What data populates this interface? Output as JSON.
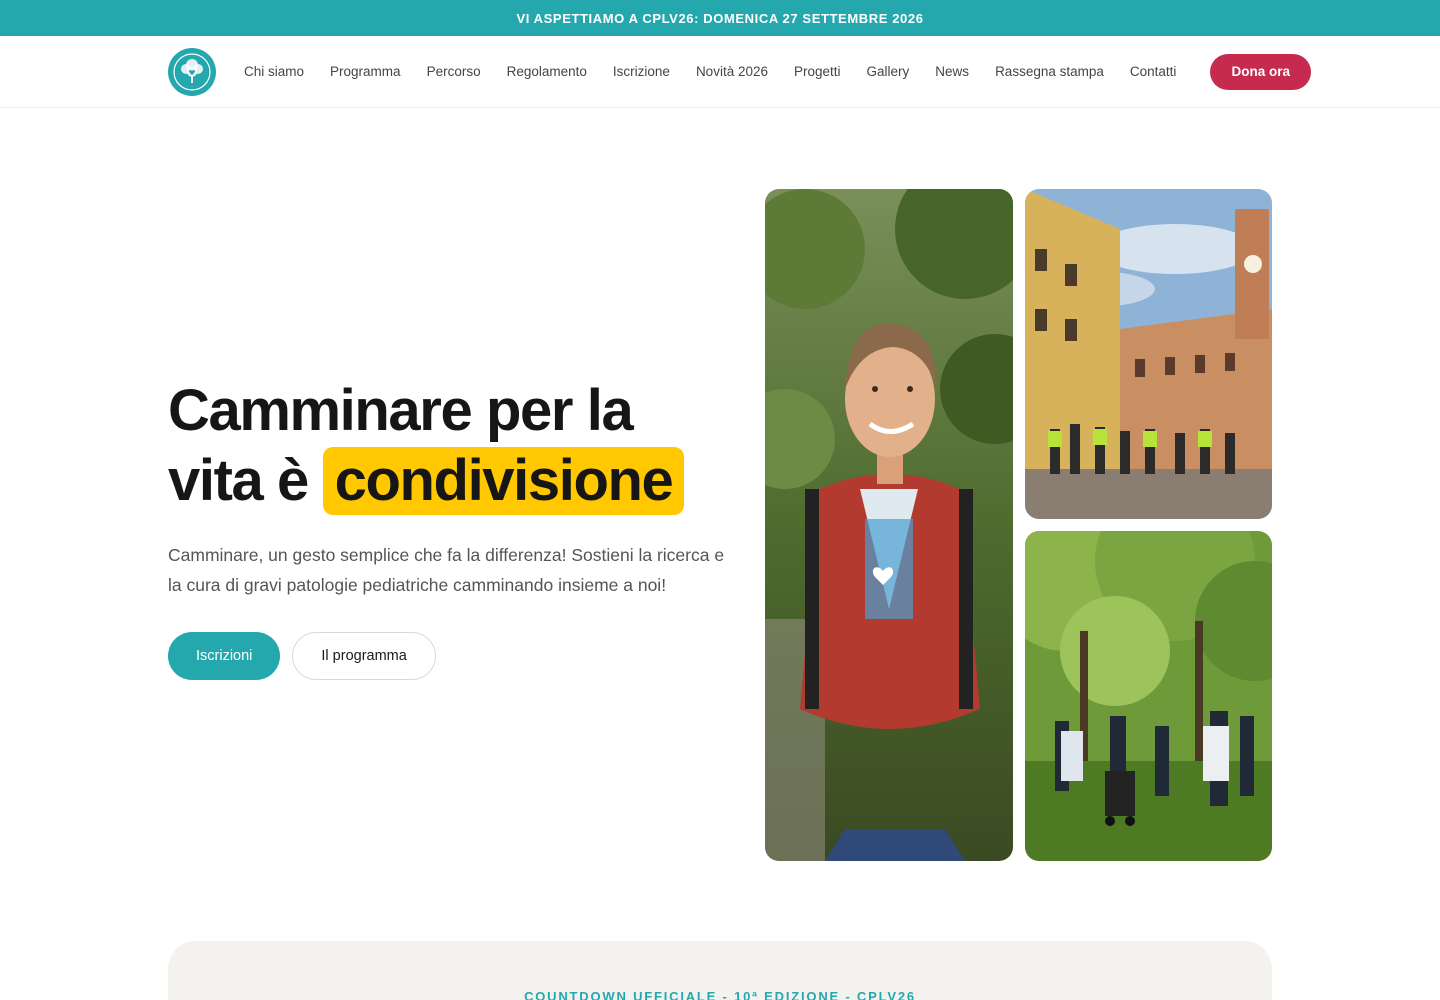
{
  "topbar": {
    "text": "VI ASPETTIAMO A CPLV26: DOMENICA 27 SETTEMBRE 2026"
  },
  "nav": {
    "logo_icon": "tree-heart-logo-icon",
    "items": [
      {
        "label": "Chi siamo"
      },
      {
        "label": "Programma"
      },
      {
        "label": "Percorso"
      },
      {
        "label": "Regolamento"
      },
      {
        "label": "Iscrizione"
      },
      {
        "label": "Novità 2026"
      },
      {
        "label": "Progetti"
      },
      {
        "label": "Gallery"
      },
      {
        "label": "News"
      },
      {
        "label": "Rassegna stampa"
      },
      {
        "label": "Contatti"
      }
    ],
    "donate_label": "Dona ora"
  },
  "hero": {
    "title_line1": "Camminare per la",
    "title_line2": "vita è",
    "title_highlight": "condivisione",
    "subtitle": "Camminare, un gesto semplice che fa la differenza! Sostieni la ricerca e la cura di gravi patologie pediatriche camminando insieme a noi!",
    "primary_button": "Iscrizioni",
    "secondary_button": "Il programma"
  },
  "countdown": {
    "label": "COUNTDOWN UFFICIALE - 10ª EDIZIONE - CPLV26"
  },
  "colors": {
    "teal": "#24a8ae",
    "donate_red": "#c62a4e",
    "highlight_yellow": "#ffc800",
    "countdown_bg": "#f3f2ee"
  }
}
